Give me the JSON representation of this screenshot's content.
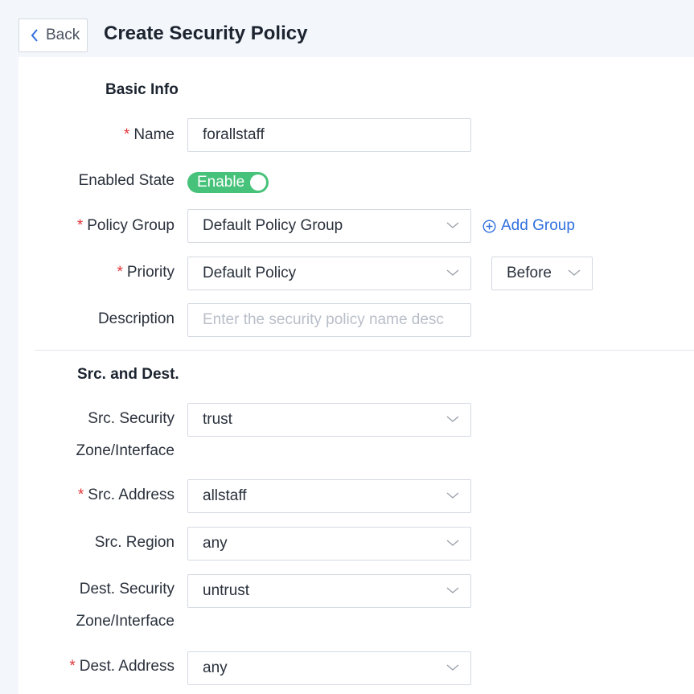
{
  "header": {
    "back_label": "Back",
    "title": "Create Security Policy"
  },
  "basic_info": {
    "section_title": "Basic Info",
    "name": {
      "label": "Name",
      "value": "forallstaff",
      "required": true
    },
    "enabled_state": {
      "label": "Enabled State",
      "toggle_label": "Enable",
      "on": true,
      "color": "#47c27a"
    },
    "policy_group": {
      "label": "Policy Group",
      "value": "Default Policy Group",
      "required": true,
      "add_label": "Add Group"
    },
    "priority": {
      "label": "Priority",
      "value": "Default Policy",
      "position_value": "Before",
      "required": true
    },
    "description": {
      "label": "Description",
      "placeholder": "Enter the security policy name desc"
    }
  },
  "src_dest": {
    "section_title": "Src. and Dest.",
    "src_zone": {
      "label_line1": "Src. Security",
      "label_line2": "Zone/Interface",
      "value": "trust"
    },
    "src_address": {
      "label": "Src. Address",
      "value": "allstaff",
      "required": true
    },
    "src_region": {
      "label": "Src. Region",
      "value": "any"
    },
    "dest_zone": {
      "label_line1": "Dest. Security",
      "label_line2": "Zone/Interface",
      "value": "untrust"
    },
    "dest_address": {
      "label": "Dest. Address",
      "value": "any",
      "required": true
    }
  },
  "colors": {
    "accent": "#2f6fde",
    "required": "#e2353a",
    "toggle_on": "#47c27a"
  },
  "icons": [
    "chevron-left-icon",
    "chevron-down-icon",
    "plus-circle-icon"
  ]
}
